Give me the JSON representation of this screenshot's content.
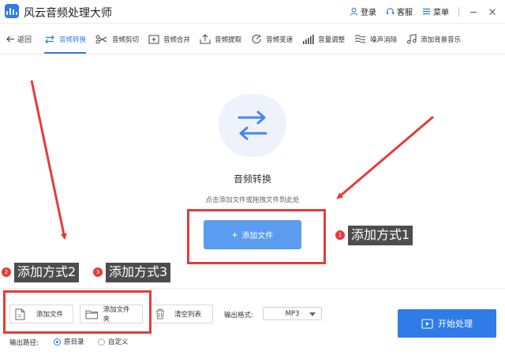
{
  "app": {
    "title": "风云音频处理大师",
    "login": "登录",
    "service": "客服",
    "menu": "菜单"
  },
  "nav": {
    "back": "返回",
    "items": [
      {
        "label": "音频转换",
        "icon": "convert-icon",
        "active": true
      },
      {
        "label": "音频剪切",
        "icon": "scissors-icon",
        "active": false
      },
      {
        "label": "音频合并",
        "icon": "merge-icon",
        "active": false
      },
      {
        "label": "音频提取",
        "icon": "extract-icon",
        "active": false
      },
      {
        "label": "音频变速",
        "icon": "speed-icon",
        "active": false
      },
      {
        "label": "音量调整",
        "icon": "volume-bars-icon",
        "active": false
      },
      {
        "label": "噪声消除",
        "icon": "noise-icon",
        "active": false
      },
      {
        "label": "添加背景音乐",
        "icon": "music-note-icon",
        "active": false
      }
    ]
  },
  "drop": {
    "title": "音频转换",
    "hint": "点击添加文件或拖拽文件到此处",
    "add_file": "添加文件"
  },
  "toolbar": {
    "add_file": "添加文件",
    "add_folder": "添加文件夹",
    "clear_list": "清空列表",
    "format_label": "输出格式:",
    "format_value": "MP3",
    "output_path_label": "输出路径:",
    "path_original": "原目录",
    "path_custom": "自定义",
    "start": "开始处理"
  },
  "annotations": {
    "m1": {
      "num": "1",
      "text": "添加方式1"
    },
    "m2": {
      "num": "2",
      "text": "添加方式2"
    },
    "m3": {
      "num": "3",
      "text": "添加方式3"
    }
  },
  "colors": {
    "accent": "#2f7be8",
    "button_light": "#5b9cf1",
    "annotation_red": "#e53b3b",
    "tag_bg": "#4d4d4d"
  }
}
